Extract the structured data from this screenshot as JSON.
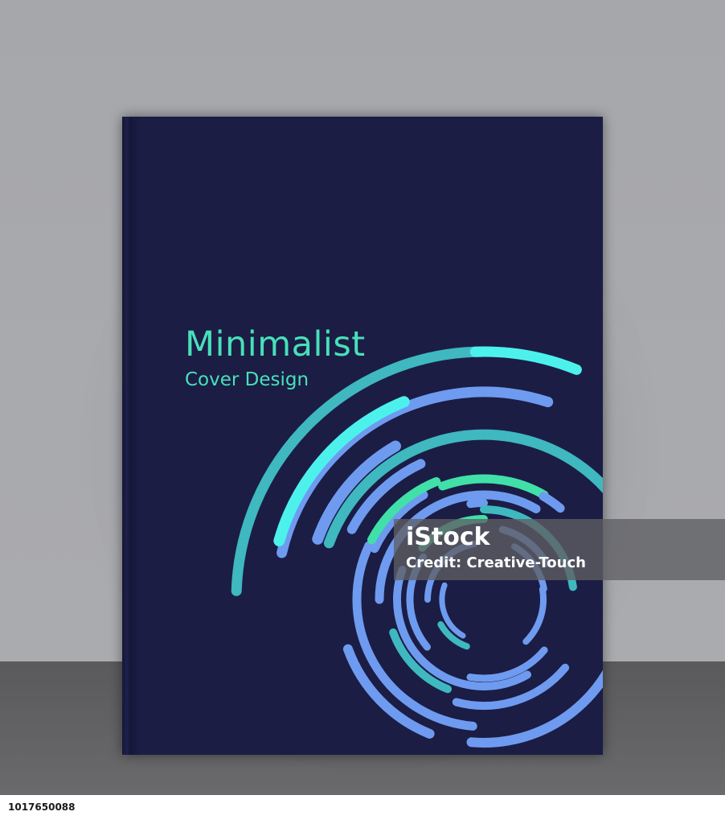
{
  "cover": {
    "title": "Minimalist",
    "subtitle": "Cover Design"
  },
  "watermark": {
    "logo": "iStock",
    "credit": "Credit: Creative-Touch"
  },
  "footer": {
    "image_id": "1017650088"
  },
  "colors": {
    "wall": "#a8a9ad",
    "floor": "#606062",
    "cover": "#1b1d45",
    "accent_green": "#48e0b9",
    "ring_blue": "#6e9bef",
    "ring_cyan": "#4df1ec",
    "ring_teal": "#3fb8c0",
    "ring_mint": "#41e0a8"
  }
}
